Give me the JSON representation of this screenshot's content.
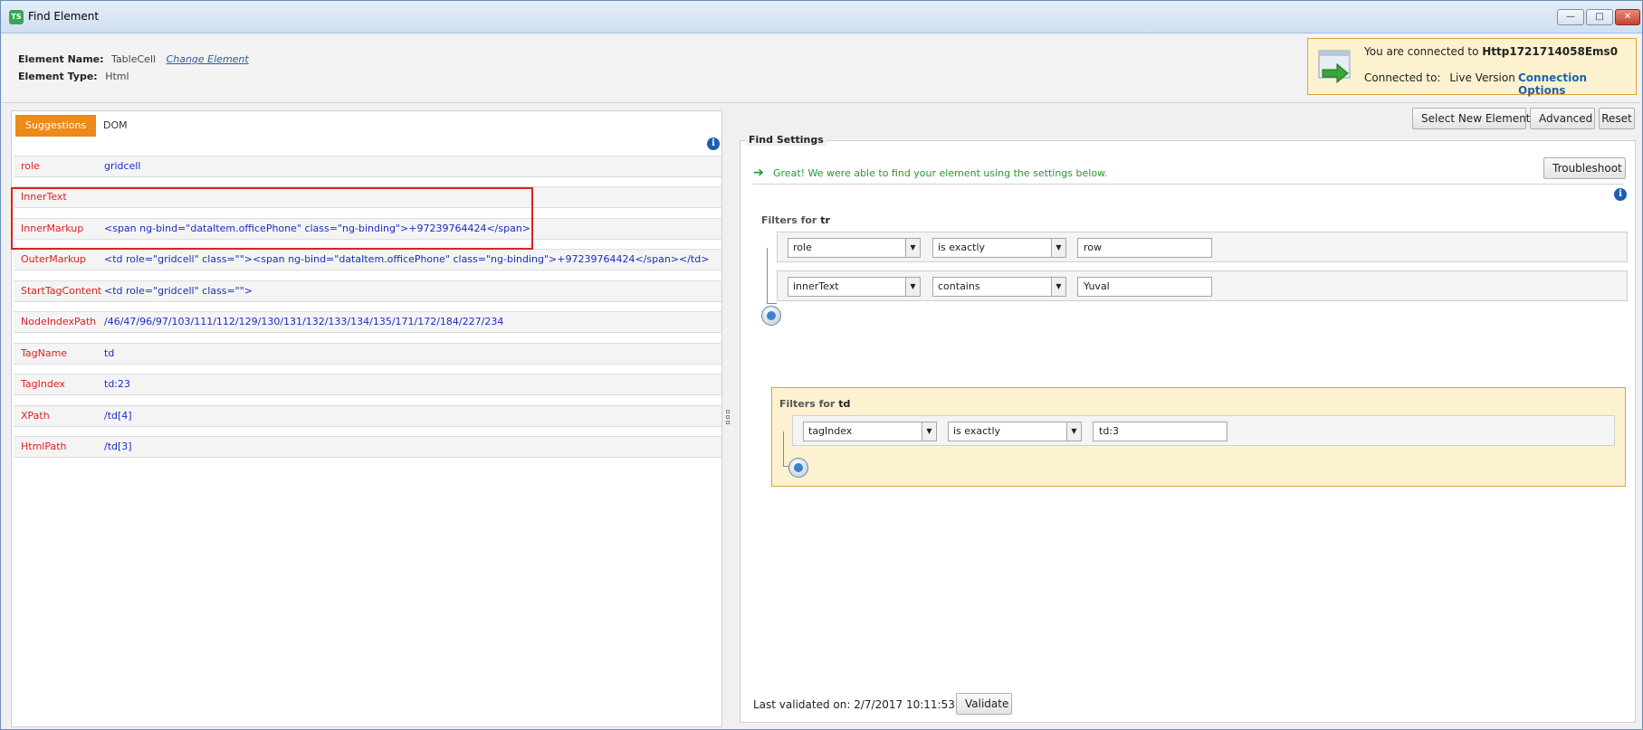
{
  "window": {
    "title": "Find Element",
    "app_icon": "TS",
    "minimize_icon": "minimize-icon",
    "maximize_icon": "maximize-icon",
    "close_icon": "close-icon"
  },
  "element_info": {
    "name_label": "Element Name:",
    "name_value": "TableCell",
    "change_link": "Change Element",
    "type_label": "Element Type:",
    "type_value": "Html"
  },
  "connection": {
    "line1_prefix": "You are connected to",
    "line1_target": "Http1721714058Ems0",
    "line2_label": "Connected to:",
    "line2_value": "Live Version",
    "options_link": "Connection Options",
    "accent_color": "#e0a23a"
  },
  "left_tabs": [
    {
      "label": "Suggestions",
      "active": true
    },
    {
      "label": "DOM",
      "active": false
    }
  ],
  "properties": [
    {
      "name": "role",
      "value": "gridcell"
    },
    {
      "name": "InnerText",
      "value": ""
    },
    {
      "name": "InnerMarkup",
      "value": "<span ng-bind=\"dataItem.officePhone\" class=\"ng-binding\">+97239764424</span>"
    },
    {
      "name": "OuterMarkup",
      "value": "<td role=\"gridcell\" class=\"\"><span ng-bind=\"dataItem.officePhone\" class=\"ng-binding\">+97239764424</span></td>"
    },
    {
      "name": "StartTagContent",
      "value": "<td role=\"gridcell\" class=\"\">"
    },
    {
      "name": "NodeIndexPath",
      "value": "/46/47/96/97/103/111/112/129/130/131/132/133/134/135/171/172/184/227/234"
    },
    {
      "name": "TagName",
      "value": "td"
    },
    {
      "name": "TagIndex",
      "value": "td:23"
    },
    {
      "name": "XPath",
      "value": "/td[4]"
    },
    {
      "name": "HtmlPath",
      "value": "/td[3]"
    }
  ],
  "toolbar": {
    "select_new": "Select New Element",
    "advanced": "Advanced",
    "reset": "Reset"
  },
  "find_settings": {
    "legend": "Find Settings",
    "success_message": "Great! We were able to find your element using the settings below.",
    "troubleshoot": "Troubleshoot",
    "filters_prefix": "Filters for",
    "tr_tag": "tr",
    "tr_filters": [
      {
        "property": "role",
        "operator": "is exactly",
        "value": "row"
      },
      {
        "property": "innerText",
        "operator": "contains",
        "value": "Yuval"
      }
    ],
    "td_tag": "td",
    "td_filters": [
      {
        "property": "tagIndex",
        "operator": "is exactly",
        "value": "td:3"
      }
    ]
  },
  "footer": {
    "last_validated_label": "Last validated on: 2/7/2017 10:11:53 AM",
    "validate_button": "Validate"
  }
}
